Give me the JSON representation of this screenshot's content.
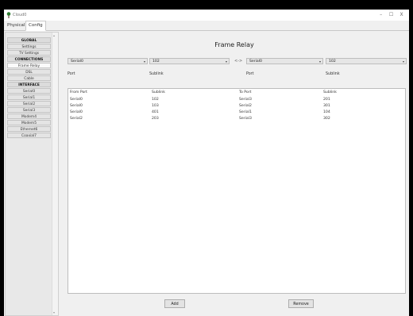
{
  "window": {
    "title": "Cloud0",
    "controls": [
      "–",
      "☐",
      "X"
    ]
  },
  "tabs": [
    {
      "label": "Physical",
      "active": false
    },
    {
      "label": "Config",
      "active": true
    }
  ],
  "sidebar": {
    "items": [
      {
        "label": "GLOBAL",
        "header": true
      },
      {
        "label": "Settings"
      },
      {
        "label": "TV Settings"
      },
      {
        "label": "CONNECTIONS",
        "header": true
      },
      {
        "label": "Frame Relay",
        "selected": true
      },
      {
        "label": "DSL"
      },
      {
        "label": "Cable"
      },
      {
        "label": "INTERFACE",
        "header": true
      },
      {
        "label": "Serial0"
      },
      {
        "label": "Serial1"
      },
      {
        "label": "Serial2"
      },
      {
        "label": "Serial3"
      },
      {
        "label": "Modem4"
      },
      {
        "label": "Modem5"
      },
      {
        "label": "Ethernet6"
      },
      {
        "label": "Coaxial7"
      }
    ]
  },
  "main": {
    "title": "Frame Relay",
    "left_port": "Serial0",
    "left_sublink": "102",
    "swap_symbol": "<->",
    "right_port": "Serial0",
    "right_sublink": "102",
    "labels": {
      "port_left": "Port",
      "sublink_left": "Sublink",
      "port_right": "Port",
      "sublink_right": "Sublink"
    },
    "table": {
      "columns": [
        "From Port",
        "Sublink",
        "To Port",
        "Sublink"
      ],
      "rows": [
        [
          "Serial0",
          "102",
          "Serial3",
          "201"
        ],
        [
          "Serial0",
          "103",
          "Serial2",
          "301"
        ],
        [
          "Serial0",
          "401",
          "Serial1",
          "104"
        ],
        [
          "Serial2",
          "203",
          "Serial3",
          "302"
        ]
      ]
    },
    "add_label": "Add",
    "remove_label": "Remove"
  }
}
